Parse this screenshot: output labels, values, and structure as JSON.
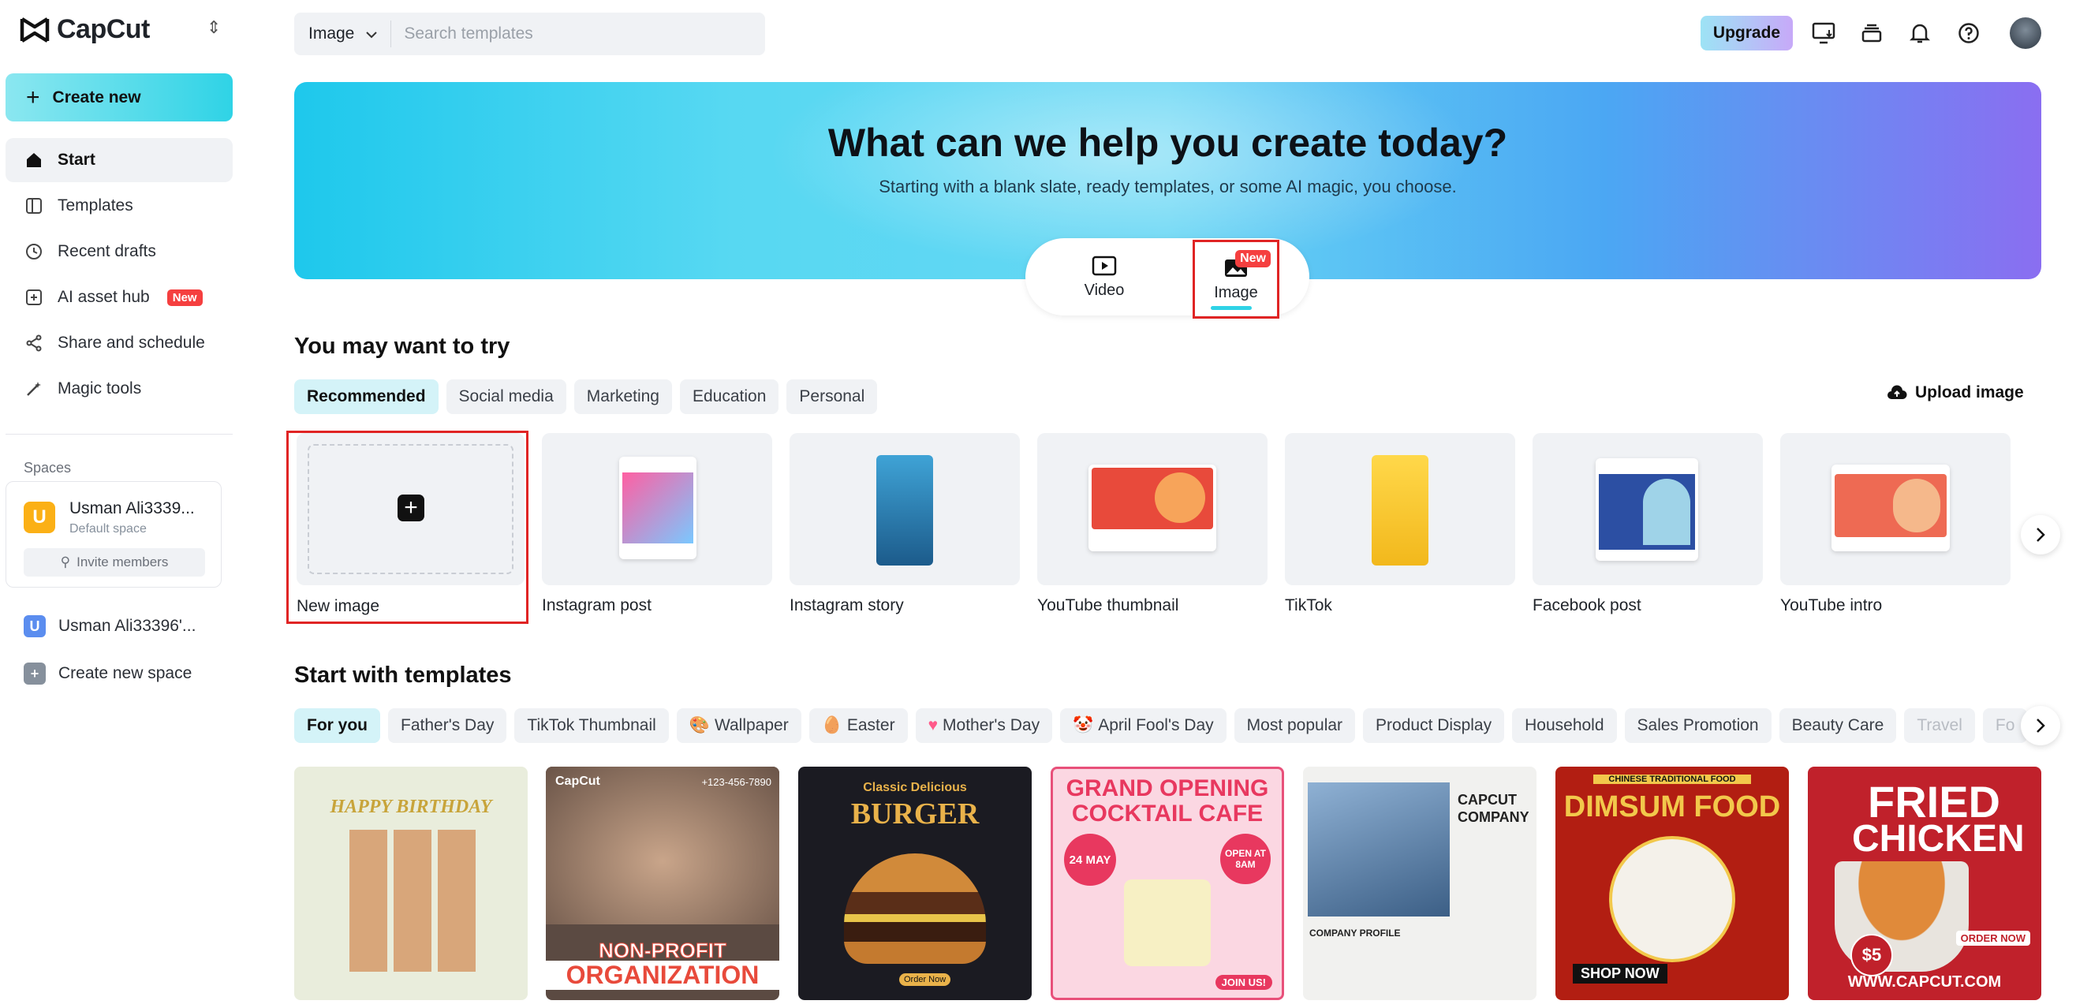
{
  "app": {
    "name": "CapCut"
  },
  "sidebar": {
    "create_label": "Create new",
    "items": [
      {
        "label": "Start",
        "icon": "home-icon"
      },
      {
        "label": "Templates",
        "icon": "templates-icon"
      },
      {
        "label": "Recent drafts",
        "icon": "clock-icon"
      },
      {
        "label": "AI asset hub",
        "icon": "ai-asset-icon",
        "badge": "New"
      },
      {
        "label": "Share and schedule",
        "icon": "share-icon"
      },
      {
        "label": "Magic tools",
        "icon": "magic-wand-icon"
      }
    ],
    "spaces_label": "Spaces",
    "space": {
      "initial": "U",
      "name": "Usman Ali3339...",
      "sub": "Default space",
      "invite_label": "Invite members"
    },
    "other_space": {
      "initial": "U",
      "name": "Usman Ali33396'..."
    },
    "create_space_label": "Create new space"
  },
  "topbar": {
    "search_type": "Image",
    "search_placeholder": "Search templates",
    "upgrade_label": "Upgrade"
  },
  "hero": {
    "title": "What can we help you create today?",
    "subtitle": "Starting with a blank slate, ready templates, or some AI magic, you choose.",
    "modes": [
      {
        "label": "Video"
      },
      {
        "label": "Image",
        "badge": "New"
      }
    ]
  },
  "try_section": {
    "title": "You may want to try",
    "tabs": [
      "Recommended",
      "Social media",
      "Marketing",
      "Education",
      "Personal"
    ],
    "upload_label": "Upload image",
    "cards": [
      "New image",
      "Instagram post",
      "Instagram story",
      "YouTube thumbnail",
      "TikTok",
      "Facebook post",
      "YouTube intro"
    ]
  },
  "templates_section": {
    "title": "Start with templates",
    "tabs": [
      "For you",
      "Father's Day",
      "TikTok Thumbnail",
      "Wallpaper",
      "Easter",
      "Mother's Day",
      "April Fool's Day",
      "Most popular",
      "Product Display",
      "Household",
      "Sales Promotion",
      "Beauty Care",
      "Travel",
      "Fo"
    ],
    "cards": [
      {
        "text1": "HAPPY BIRTHDAY"
      },
      {
        "text1": "NON-PROFIT",
        "text2": "ORGANIZATION",
        "brand": "CapCut",
        "phone": "+123-456-7890"
      },
      {
        "text1": "Classic Delicious",
        "text2": "BURGER",
        "order": "Order Now"
      },
      {
        "text1": "GRAND OPENING",
        "text2": "COCKTAIL CAFE",
        "date": "24 MAY",
        "open": "OPEN AT 8AM",
        "join": "JOIN US!"
      },
      {
        "text1": "CAPCUT",
        "text2": "COMPANY",
        "profile": "COMPANY PROFILE"
      },
      {
        "text1": "DIMSUM FOOD",
        "tag": "CHINESE TRADITIONAL FOOD",
        "shop": "SHOP NOW"
      },
      {
        "text1": "FRIED",
        "text2": "CHICKEN",
        "price": "$5",
        "order": "ORDER NOW",
        "url": "WWW.CAPCUT.COM"
      }
    ]
  },
  "colors": {
    "accent": "#2fd3e6",
    "badge": "#f53f3f",
    "highlight": "#e02424"
  }
}
